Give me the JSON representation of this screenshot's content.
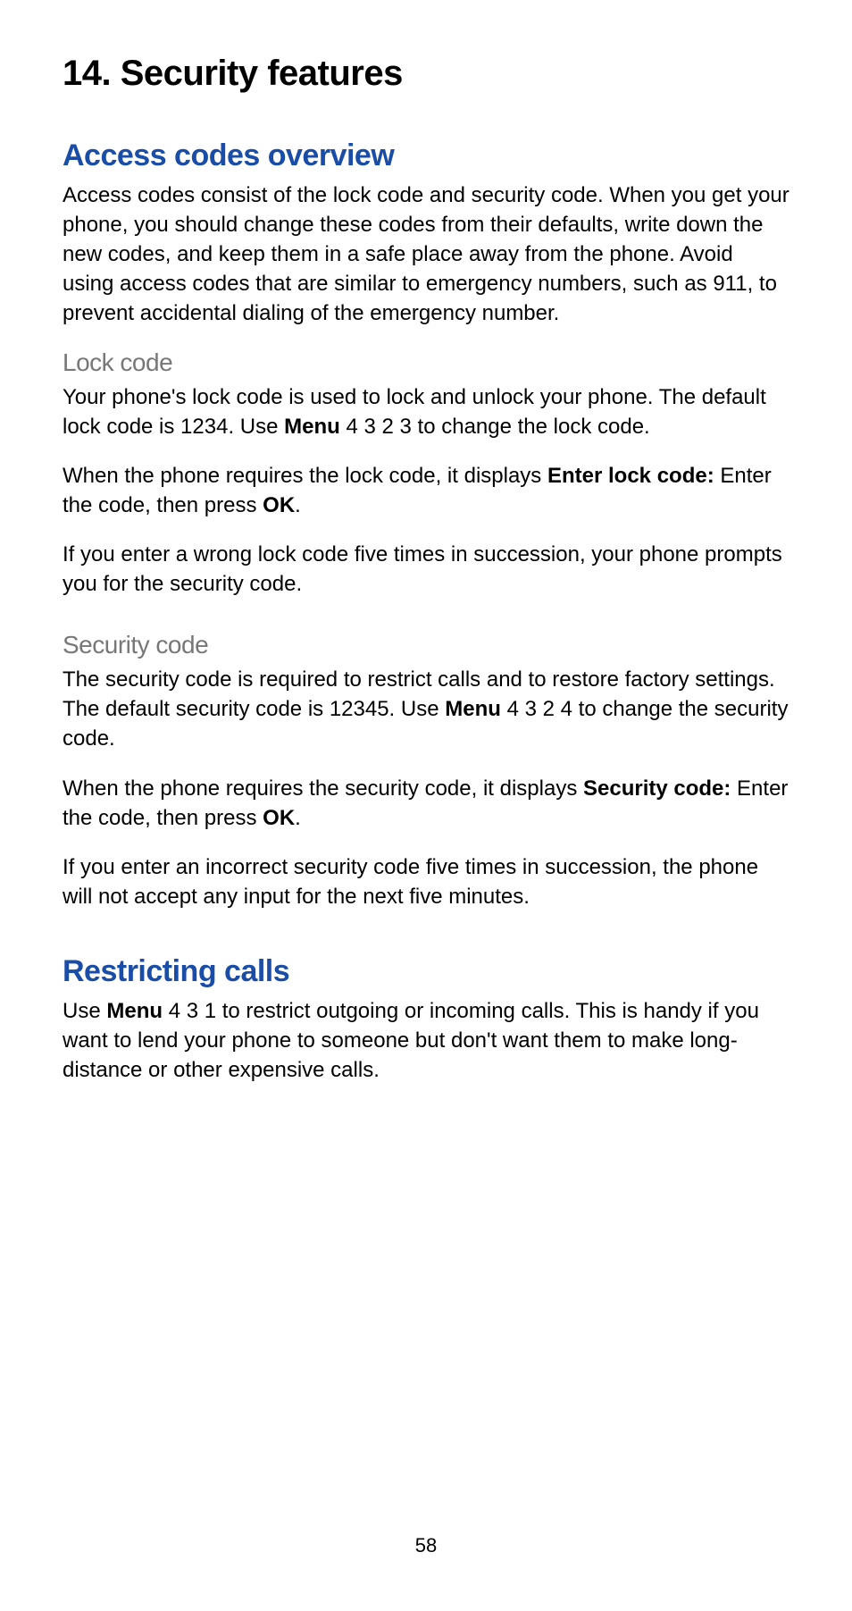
{
  "chapter": {
    "number": "14.",
    "title": "Security features"
  },
  "sections": {
    "access": {
      "heading": "Access codes overview",
      "intro": "Access codes consist of the lock code and security code. When you get your phone, you should change these codes from their defaults, write down the new codes, and keep them in a safe place away from the phone. Avoid using access codes that are similar to emergency numbers, such as 911, to prevent accidental dialing of the emergency number.",
      "lock": {
        "heading": "Lock code",
        "p1_a": "Your phone's lock code is used to lock and unlock your phone. The default lock code is 1234. Use ",
        "p1_bold": "Menu",
        "p1_b": " 4 3 2 3 to change the lock code.",
        "p2_a": "When the phone requires the lock code, it displays ",
        "p2_bold1": "Enter lock code:",
        "p2_b": "  Enter the code, then press ",
        "p2_bold2": "OK",
        "p2_c": ".",
        "p3": "If you enter a wrong lock code five times in succession, your phone prompts you for the security code."
      },
      "security": {
        "heading": "Security code",
        "p1_a": "The security code is required to restrict calls and to restore factory settings. The default security code is 12345. Use ",
        "p1_bold": "Menu",
        "p1_b": " 4 3 2 4 to change the security code.",
        "p2_a": "When the phone requires the security code, it displays ",
        "p2_bold1": "Security code:",
        "p2_b": "  Enter the code, then press ",
        "p2_bold2": "OK",
        "p2_c": ".",
        "p3": "If you enter an incorrect security code five times in succession, the phone will not accept any input for the next five minutes."
      }
    },
    "restrict": {
      "heading": "Restricting calls",
      "p1_a": "Use ",
      "p1_bold": "Menu",
      "p1_b": " 4 3 1 to restrict outgoing or incoming calls. This is handy if you want to lend your phone to someone but don't want them to make long-distance or other expensive calls."
    }
  },
  "page_number": "58"
}
